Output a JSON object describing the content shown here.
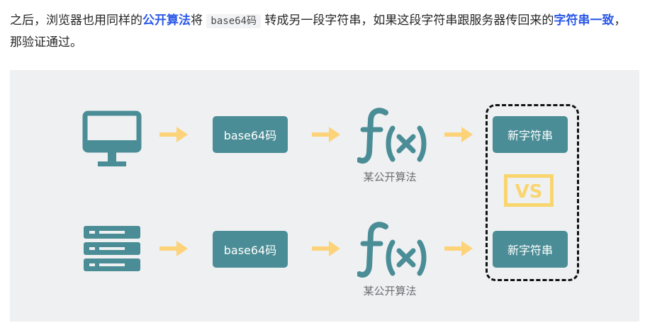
{
  "paragraph": {
    "text1": "之后，浏览器也用同样的",
    "highlight1": "公开算法",
    "text2": "将",
    "code": "base64码",
    "text3": "转成另一段字符串，如果这段字符串跟服务器传回来的",
    "highlight2": "字符串一致",
    "text4": "，那验证通过。"
  },
  "diagram": {
    "top_row": {
      "source_icon": "monitor-icon",
      "encoded_label": "base64码",
      "algorithm_label": "某公开算法",
      "result_label": "新字符串"
    },
    "bottom_row": {
      "source_icon": "server-icon",
      "encoded_label": "base64码",
      "algorithm_label": "某公开算法",
      "result_label": "新字符串"
    },
    "comparison_label": "VS",
    "colors": {
      "teal": "#4a8d96",
      "arrow_yellow": "#fdd37a",
      "vs_yellow": "#f9d56e",
      "background": "#eff0f2",
      "highlight_blue": "#2b58e8"
    }
  }
}
